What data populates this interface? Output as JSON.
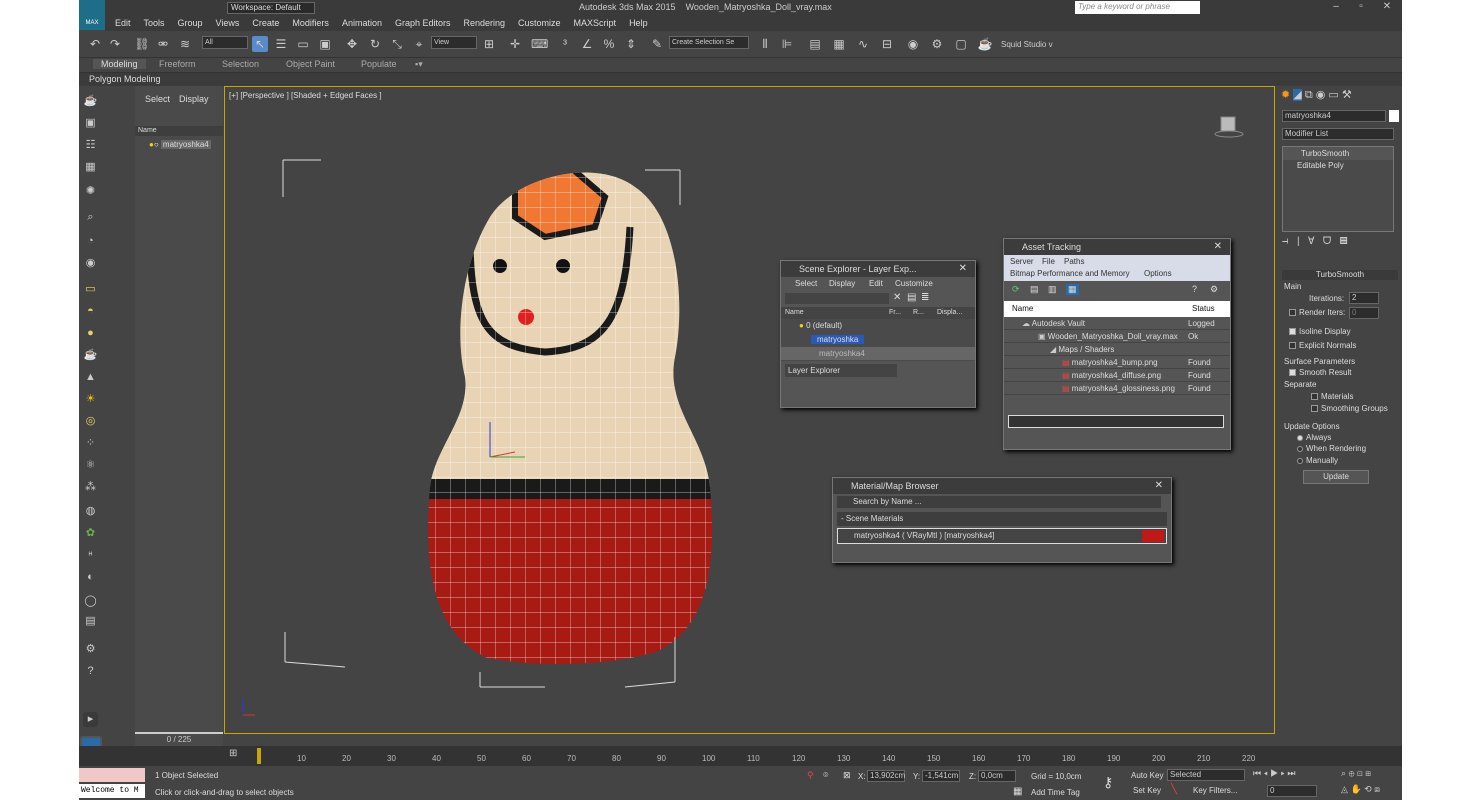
{
  "app": {
    "title": "Autodesk 3ds Max 2015",
    "file": "Wooden_Matryoshka_Doll_vray.max",
    "logo": "MAX",
    "workspace": "Workspace: Default",
    "search_placeholder": "Type a keyword or phrase"
  },
  "menu": [
    "Edit",
    "Tools",
    "Group",
    "Views",
    "Create",
    "Modifiers",
    "Animation",
    "Graph Editors",
    "Rendering",
    "Customize",
    "MAXScript",
    "Help"
  ],
  "toolbar": {
    "filter": "All",
    "refcoord": "View",
    "selection_set": "Create Selection Se",
    "studio": "Squid Studio v"
  },
  "ribbon": {
    "tabs": [
      "Modeling",
      "Freeform",
      "Selection",
      "Object Paint",
      "Populate"
    ],
    "active": "Modeling",
    "sub": "Polygon Modeling"
  },
  "explorer": {
    "tabs": [
      "Select",
      "Display"
    ],
    "header": "Name",
    "items": [
      "matryoshka4"
    ],
    "frame": "0 / 225"
  },
  "viewport": {
    "label": "[+] [Perspective ] [Shaded + Edged Faces ]"
  },
  "scene_explorer": {
    "title": "Scene Explorer - Layer Exp...",
    "menu": [
      "Select",
      "Display",
      "Edit",
      "Customize"
    ],
    "columns": [
      "Name",
      "Fr...",
      "R...",
      "Displa..."
    ],
    "rows": [
      "0 (default)",
      "matryoshka",
      "matryoshka4"
    ],
    "footer": "Layer Explorer"
  },
  "asset_tracking": {
    "title": "Asset Tracking",
    "menu": [
      "Server",
      "File",
      "Paths"
    ],
    "menu2": [
      "Bitmap Performance and Memory",
      "Options"
    ],
    "columns": [
      "Name",
      "Status"
    ],
    "rows": [
      {
        "name": "Autodesk Vault",
        "status": "Logged"
      },
      {
        "name": "Wooden_Matryoshka_Doll_vray.max",
        "status": "Ok"
      },
      {
        "name": "Maps / Shaders",
        "status": ""
      },
      {
        "name": "matryoshka4_bump.png",
        "status": "Found"
      },
      {
        "name": "matryoshka4_diffuse.png",
        "status": "Found"
      },
      {
        "name": "matryoshka4_glossiness.png",
        "status": "Found"
      }
    ]
  },
  "material_browser": {
    "title": "Material/Map Browser",
    "search": "Search by Name ...",
    "group": "- Scene Materials",
    "item": "matryoshka4  ( VRayMtl )  [matryoshka4]"
  },
  "command_panel": {
    "object_name": "matryoshka4",
    "modifier_list": "Modifier List",
    "stack": [
      "TurboSmooth",
      "Editable Poly"
    ],
    "rollout": "TurboSmooth",
    "main": "Main",
    "iterations_label": "Iterations:",
    "iterations": "2",
    "render_iters_label": "Render Iters:",
    "render_iters": "0",
    "isoline": "Isoline Display",
    "explicit": "Explicit Normals",
    "surface": "Surface Parameters",
    "smooth": "Smooth Result",
    "separate": "Separate",
    "materials": "Materials",
    "smoothing": "Smoothing Groups",
    "update_options": "Update Options",
    "always": "Always",
    "when_rendering": "When Rendering",
    "manually": "Manually",
    "update_btn": "Update"
  },
  "timeline": {
    "ticks": [
      "10",
      "20",
      "30",
      "40",
      "50",
      "60",
      "70",
      "80",
      "90",
      "100",
      "110",
      "120",
      "130",
      "140",
      "150",
      "160",
      "170",
      "180",
      "190",
      "200",
      "210",
      "220"
    ]
  },
  "status": {
    "selected": "1 Object Selected",
    "hint": "Click or click-and-drag to select objects",
    "welcome": "Welcome to M",
    "x": "13,902cm",
    "y": "-1,541cm",
    "z": "0,0cm",
    "grid": "Grid = 10,0cm",
    "add_time_tag": "Add Time Tag",
    "auto_key": "Auto Key",
    "set_key": "Set Key",
    "selected_dd": "Selected",
    "key_filters": "Key Filters...",
    "frame": "0",
    "x_label": "X:",
    "y_label": "Y:",
    "z_label": "Z:"
  }
}
